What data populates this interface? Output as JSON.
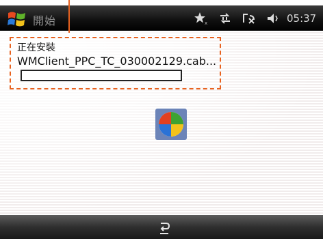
{
  "titlebar": {
    "start_label": "開始",
    "clock": "05:37",
    "icons": [
      "notification-star-icon",
      "connectivity-icon",
      "no-signal-icon",
      "speaker-icon"
    ]
  },
  "install": {
    "status": "正在安裝",
    "filename": "WMClient_PPC_TC_030002129.cab...",
    "progress_percent": 0
  },
  "softbar": {
    "icon": "back-icon"
  },
  "colors": {
    "accent": "#e8621f"
  }
}
